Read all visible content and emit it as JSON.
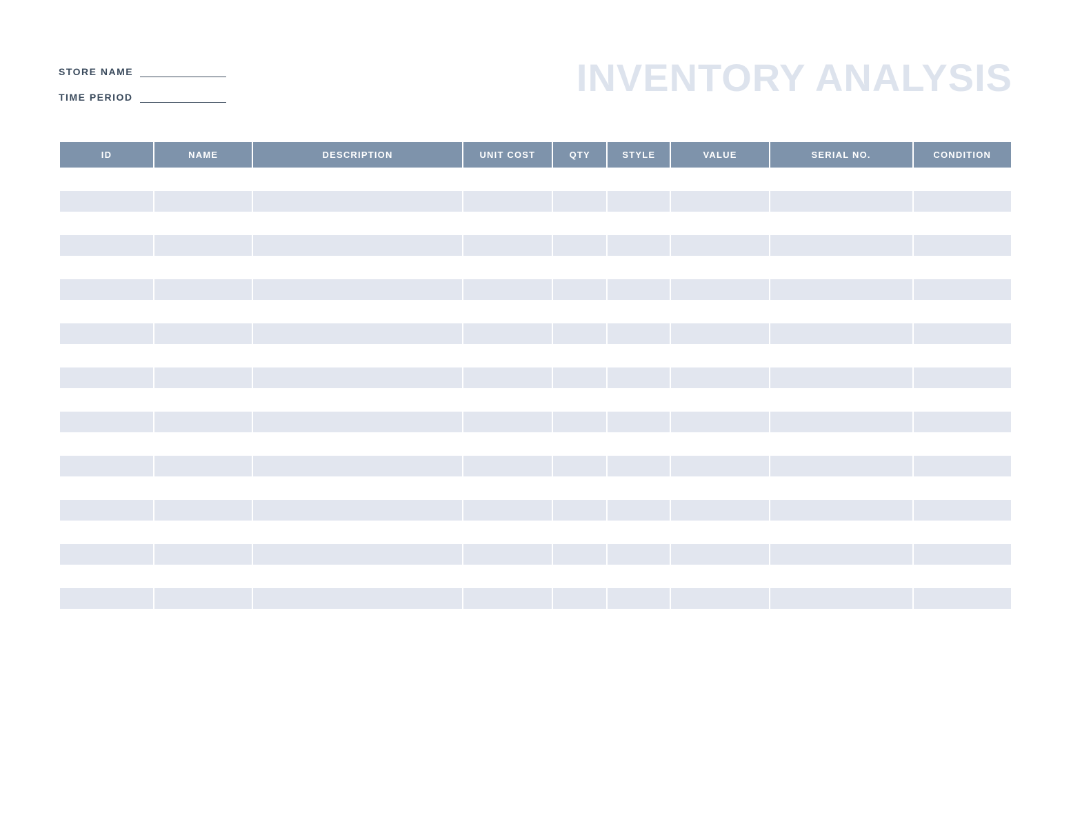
{
  "header": {
    "title": "INVENTORY ANALYSIS",
    "fields": {
      "store_name_label": "STORE NAME",
      "store_name_value": "",
      "time_period_label": "TIME PERIOD",
      "time_period_value": ""
    }
  },
  "table": {
    "columns": [
      {
        "key": "id",
        "label": "ID"
      },
      {
        "key": "name",
        "label": "NAME"
      },
      {
        "key": "description",
        "label": "DESCRIPTION"
      },
      {
        "key": "unit_cost",
        "label": "UNIT COST"
      },
      {
        "key": "qty",
        "label": "QTY"
      },
      {
        "key": "style",
        "label": "STYLE"
      },
      {
        "key": "value",
        "label": "VALUE"
      },
      {
        "key": "serial_no",
        "label": "SERIAL NO."
      },
      {
        "key": "condition",
        "label": "CONDITION"
      }
    ],
    "rows": [
      {
        "id": "",
        "name": "",
        "description": "",
        "unit_cost": "",
        "qty": "",
        "style": "",
        "value": "",
        "serial_no": "",
        "condition": ""
      },
      {
        "id": "",
        "name": "",
        "description": "",
        "unit_cost": "",
        "qty": "",
        "style": "",
        "value": "",
        "serial_no": "",
        "condition": ""
      },
      {
        "id": "",
        "name": "",
        "description": "",
        "unit_cost": "",
        "qty": "",
        "style": "",
        "value": "",
        "serial_no": "",
        "condition": ""
      },
      {
        "id": "",
        "name": "",
        "description": "",
        "unit_cost": "",
        "qty": "",
        "style": "",
        "value": "",
        "serial_no": "",
        "condition": ""
      },
      {
        "id": "",
        "name": "",
        "description": "",
        "unit_cost": "",
        "qty": "",
        "style": "",
        "value": "",
        "serial_no": "",
        "condition": ""
      },
      {
        "id": "",
        "name": "",
        "description": "",
        "unit_cost": "",
        "qty": "",
        "style": "",
        "value": "",
        "serial_no": "",
        "condition": ""
      },
      {
        "id": "",
        "name": "",
        "description": "",
        "unit_cost": "",
        "qty": "",
        "style": "",
        "value": "",
        "serial_no": "",
        "condition": ""
      },
      {
        "id": "",
        "name": "",
        "description": "",
        "unit_cost": "",
        "qty": "",
        "style": "",
        "value": "",
        "serial_no": "",
        "condition": ""
      },
      {
        "id": "",
        "name": "",
        "description": "",
        "unit_cost": "",
        "qty": "",
        "style": "",
        "value": "",
        "serial_no": "",
        "condition": ""
      },
      {
        "id": "",
        "name": "",
        "description": "",
        "unit_cost": "",
        "qty": "",
        "style": "",
        "value": "",
        "serial_no": "",
        "condition": ""
      },
      {
        "id": "",
        "name": "",
        "description": "",
        "unit_cost": "",
        "qty": "",
        "style": "",
        "value": "",
        "serial_no": "",
        "condition": ""
      },
      {
        "id": "",
        "name": "",
        "description": "",
        "unit_cost": "",
        "qty": "",
        "style": "",
        "value": "",
        "serial_no": "",
        "condition": ""
      },
      {
        "id": "",
        "name": "",
        "description": "",
        "unit_cost": "",
        "qty": "",
        "style": "",
        "value": "",
        "serial_no": "",
        "condition": ""
      },
      {
        "id": "",
        "name": "",
        "description": "",
        "unit_cost": "",
        "qty": "",
        "style": "",
        "value": "",
        "serial_no": "",
        "condition": ""
      },
      {
        "id": "",
        "name": "",
        "description": "",
        "unit_cost": "",
        "qty": "",
        "style": "",
        "value": "",
        "serial_no": "",
        "condition": ""
      },
      {
        "id": "",
        "name": "",
        "description": "",
        "unit_cost": "",
        "qty": "",
        "style": "",
        "value": "",
        "serial_no": "",
        "condition": ""
      },
      {
        "id": "",
        "name": "",
        "description": "",
        "unit_cost": "",
        "qty": "",
        "style": "",
        "value": "",
        "serial_no": "",
        "condition": ""
      },
      {
        "id": "",
        "name": "",
        "description": "",
        "unit_cost": "",
        "qty": "",
        "style": "",
        "value": "",
        "serial_no": "",
        "condition": ""
      },
      {
        "id": "",
        "name": "",
        "description": "",
        "unit_cost": "",
        "qty": "",
        "style": "",
        "value": "",
        "serial_no": "",
        "condition": ""
      },
      {
        "id": "",
        "name": "",
        "description": "",
        "unit_cost": "",
        "qty": "",
        "style": "",
        "value": "",
        "serial_no": "",
        "condition": ""
      }
    ]
  }
}
